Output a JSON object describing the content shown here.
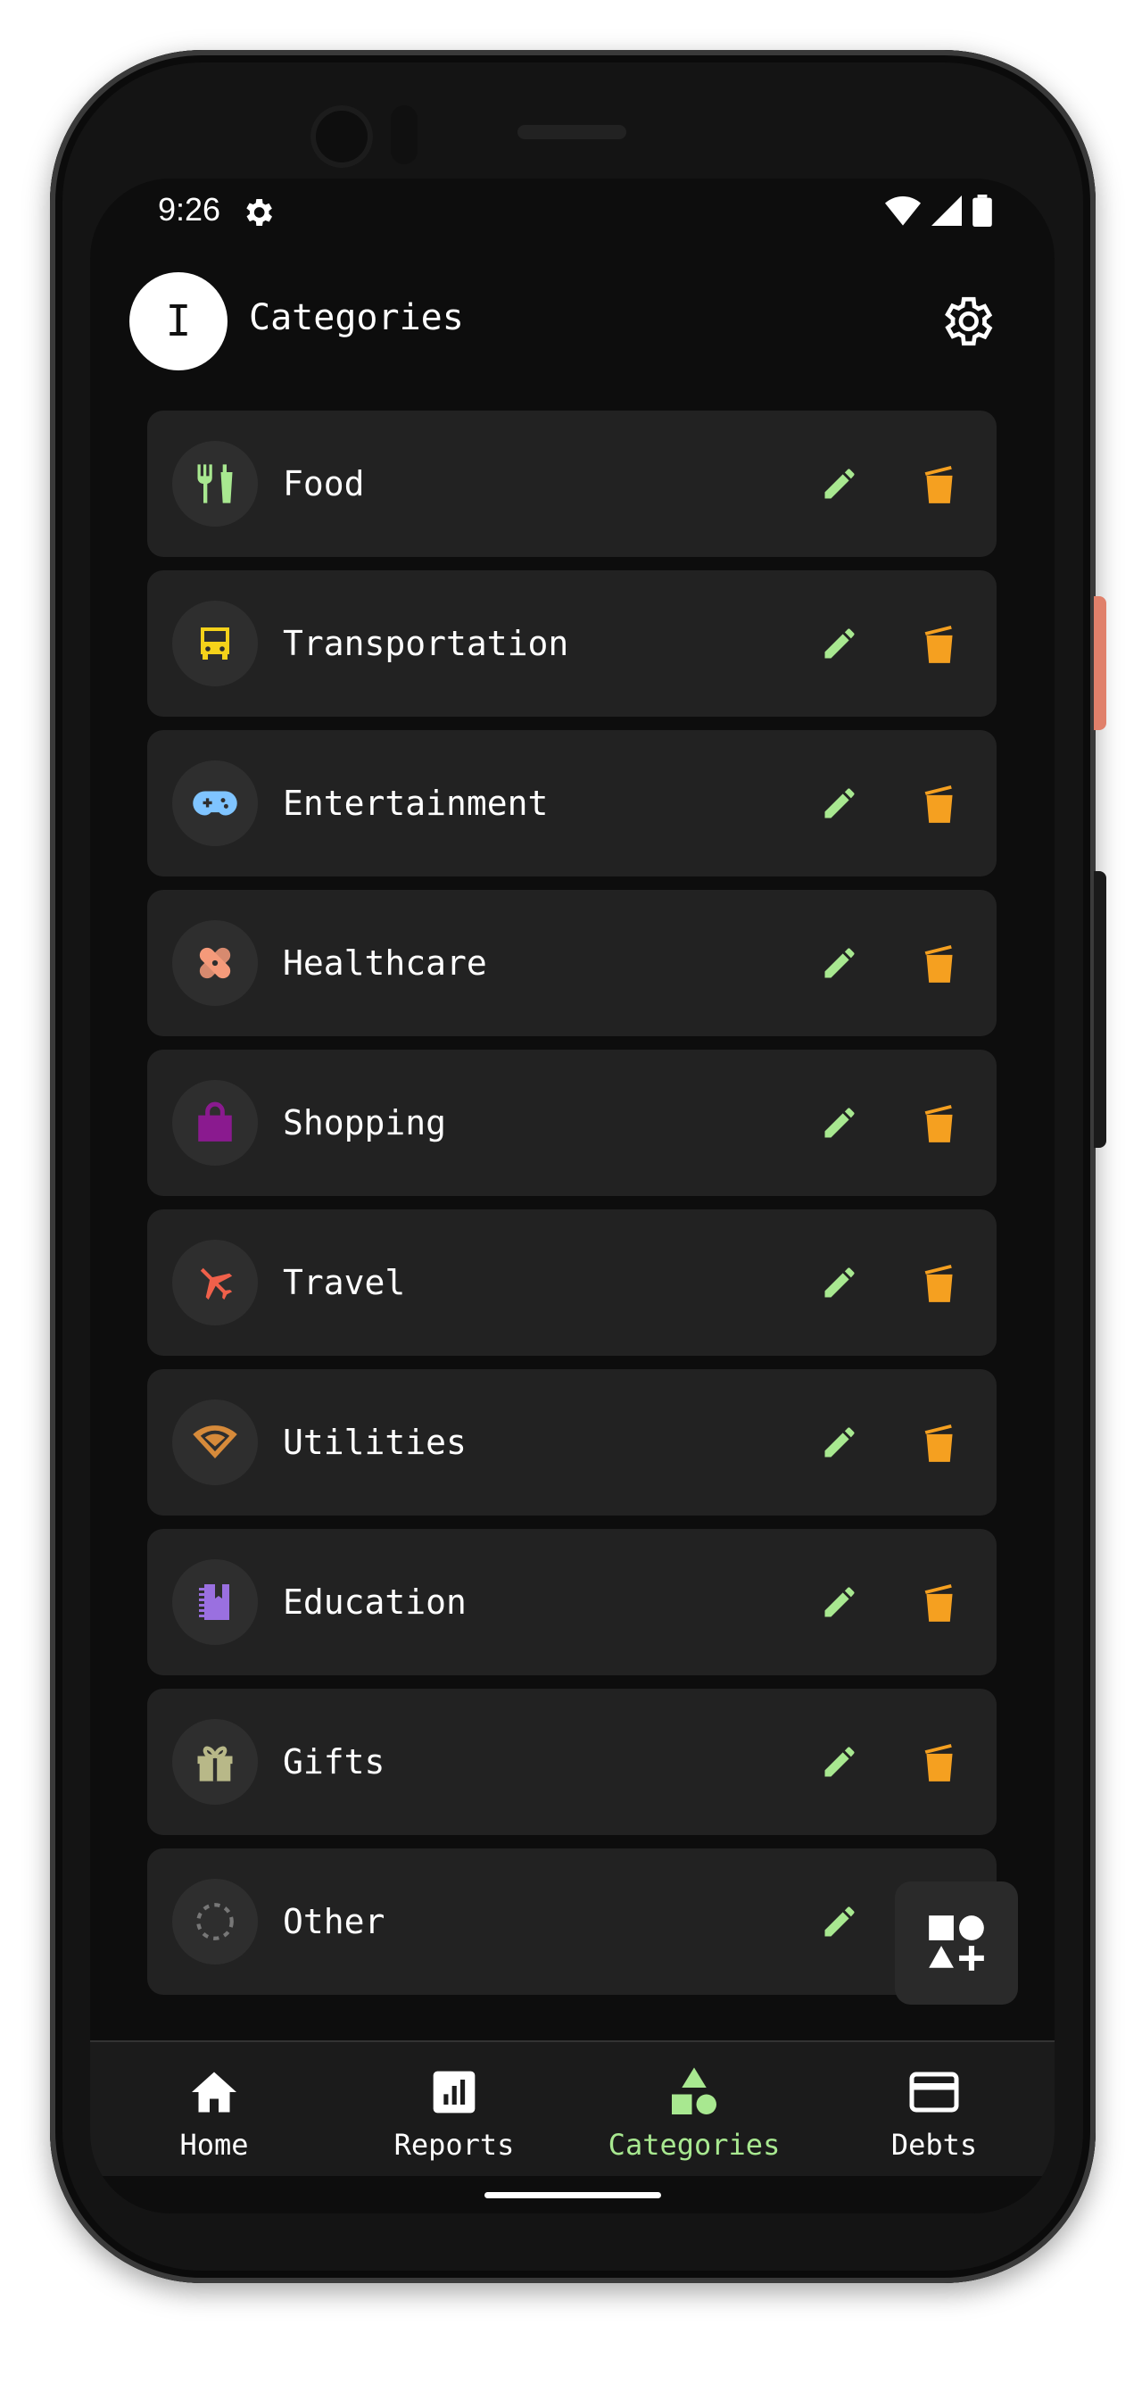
{
  "status_bar": {
    "time": "9:26"
  },
  "header": {
    "avatar_letter": "I",
    "title": "Categories"
  },
  "categories": [
    {
      "name": "Food",
      "icon": "utensils-icon",
      "color": "#a8e890"
    },
    {
      "name": "Transportation",
      "icon": "bus-icon",
      "color": "#f5d21a"
    },
    {
      "name": "Entertainment",
      "icon": "gamepad-icon",
      "color": "#7fc4ff"
    },
    {
      "name": "Healthcare",
      "icon": "bandage-icon",
      "color": "#f59a7a"
    },
    {
      "name": "Shopping",
      "icon": "shopping-bag-icon",
      "color": "#8a1a8f"
    },
    {
      "name": "Travel",
      "icon": "airplane-icon",
      "color": "#f0604a"
    },
    {
      "name": "Utilities",
      "icon": "wifi-icon",
      "color": "#d68a3a"
    },
    {
      "name": "Education",
      "icon": "notebook-icon",
      "color": "#9a70e0"
    },
    {
      "name": "Gifts",
      "icon": "gift-icon",
      "color": "#b8b888"
    },
    {
      "name": "Other",
      "icon": "dashed-circle-icon",
      "color": "#777777"
    }
  ],
  "actions": {
    "edit_color": "#a8e890",
    "delete_color": "#f5a020"
  },
  "nav": [
    {
      "label": "Home",
      "icon": "home-icon",
      "active": false
    },
    {
      "label": "Reports",
      "icon": "reports-icon",
      "active": false
    },
    {
      "label": "Categories",
      "icon": "categories-icon",
      "active": true
    },
    {
      "label": "Debts",
      "icon": "credit-card-icon",
      "active": false
    }
  ],
  "colors": {
    "accent": "#a8e890",
    "card_bg": "#222222",
    "screen_bg": "#0d0d0d"
  }
}
